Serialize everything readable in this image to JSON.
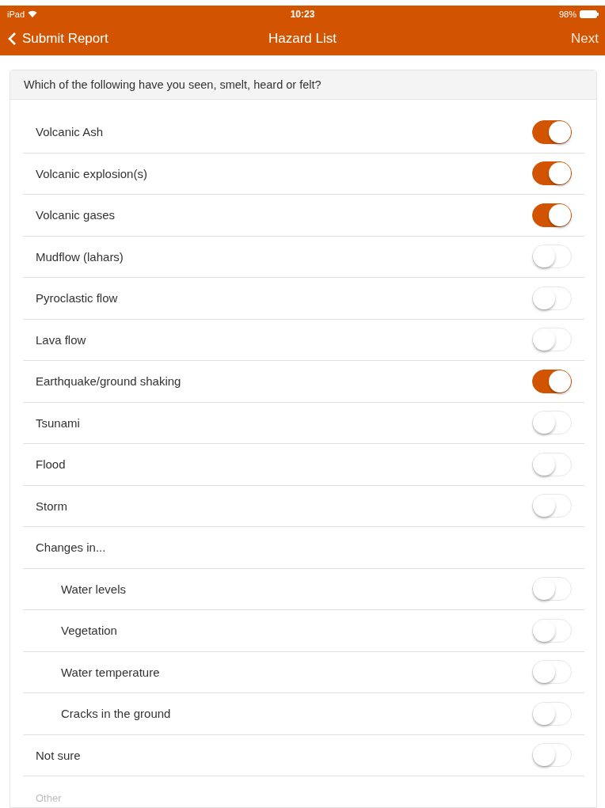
{
  "status_bar": {
    "device": "iPad",
    "time": "10:23",
    "battery": "98%"
  },
  "nav_bar": {
    "back": "Submit Report",
    "title": "Hazard List",
    "next": "Next"
  },
  "question": "Which of the following have you seen, smelt, heard or felt?",
  "items": [
    {
      "kind": "toggle",
      "label": "Volcanic Ash",
      "on": true
    },
    {
      "kind": "toggle",
      "label": "Volcanic explosion(s)",
      "on": true
    },
    {
      "kind": "toggle",
      "label": "Volcanic gases",
      "on": true
    },
    {
      "kind": "toggle",
      "label": "Mudflow (lahars)",
      "on": false
    },
    {
      "kind": "toggle",
      "label": "Pyroclastic flow",
      "on": false
    },
    {
      "kind": "toggle",
      "label": "Lava flow",
      "on": false
    },
    {
      "kind": "toggle",
      "label": "Earthquake/ground shaking",
      "on": true
    },
    {
      "kind": "toggle",
      "label": "Tsunami",
      "on": false
    },
    {
      "kind": "toggle",
      "label": "Flood",
      "on": false
    },
    {
      "kind": "toggle",
      "label": "Storm",
      "on": false
    },
    {
      "kind": "group",
      "label": "Changes in...",
      "children": [
        {
          "kind": "toggle",
          "label": "Water levels",
          "on": false
        },
        {
          "kind": "toggle",
          "label": "Vegetation",
          "on": false
        },
        {
          "kind": "toggle",
          "label": "Water temperature",
          "on": false
        },
        {
          "kind": "toggle",
          "label": "Cracks in the ground",
          "on": false
        }
      ]
    },
    {
      "kind": "toggle",
      "label": "Not sure",
      "on": false
    },
    {
      "kind": "field",
      "placeholder": "Other"
    }
  ]
}
